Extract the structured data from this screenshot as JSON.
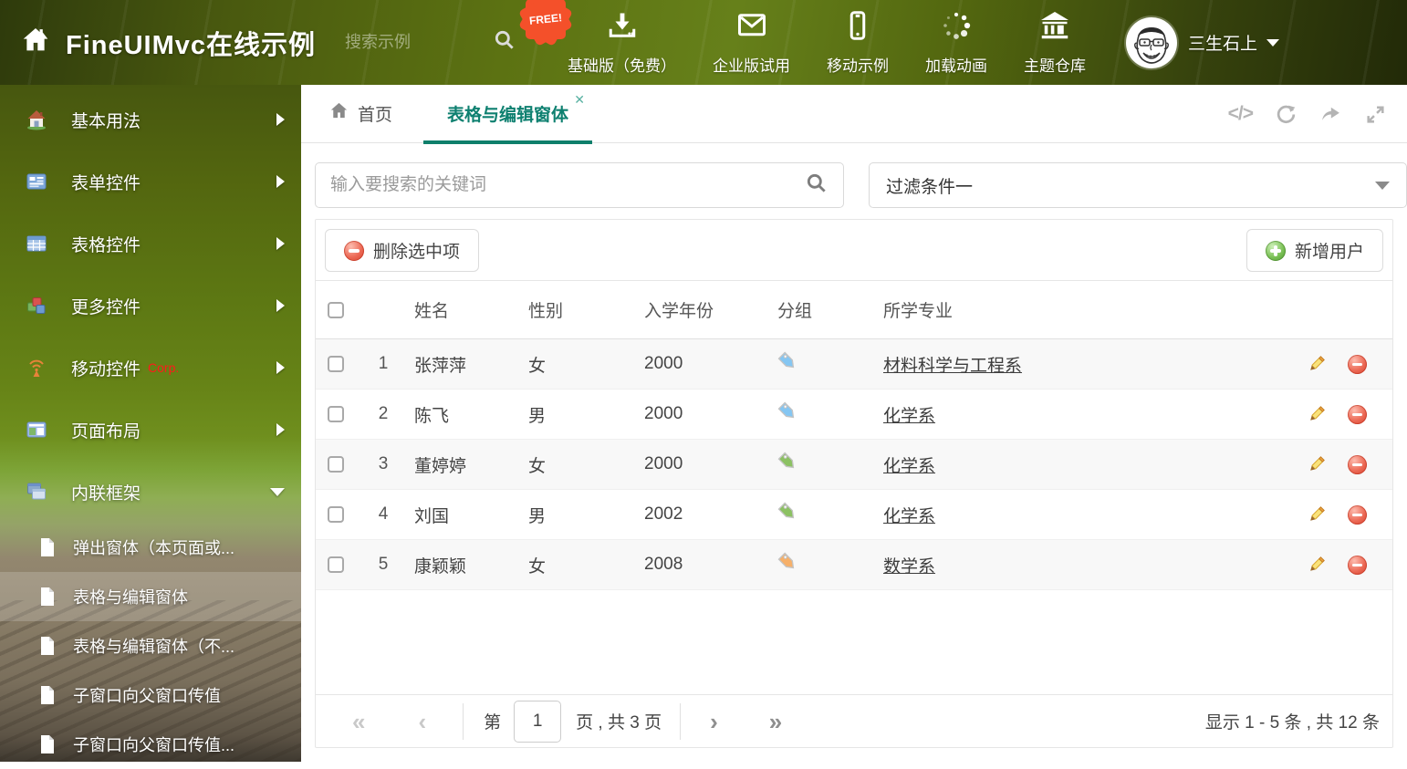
{
  "colors": {
    "accent_teal": "#0e8070",
    "badge_red": "#f4502a",
    "corp_red": "#ff1a1a",
    "tag_blue": "#85c6f2",
    "tag_green": "#8cc163",
    "tag_orange": "#f6b06a"
  },
  "header": {
    "title": "FineUIMvc在线示例",
    "search_placeholder": "搜索示例",
    "free_badge": "FREE!",
    "nav": [
      {
        "label": "基础版（免费）",
        "icon": "download-icon"
      },
      {
        "label": "企业版试用",
        "icon": "envelope-icon"
      },
      {
        "label": "移动示例",
        "icon": "mobile-icon"
      },
      {
        "label": "加载动画",
        "icon": "spinner-icon"
      },
      {
        "label": "主题仓库",
        "icon": "bank-icon"
      }
    ],
    "username": "三生石上"
  },
  "sidebar": {
    "items": [
      {
        "label": "基本用法"
      },
      {
        "label": "表单控件"
      },
      {
        "label": "表格控件"
      },
      {
        "label": "更多控件"
      },
      {
        "label": "移动控件",
        "badge": "Corp."
      },
      {
        "label": "页面布局"
      },
      {
        "label": "内联框架"
      }
    ],
    "subitems": [
      {
        "label": "弹出窗体（本页面或..."
      },
      {
        "label": "表格与编辑窗体"
      },
      {
        "label": "表格与编辑窗体（不..."
      },
      {
        "label": "子窗口向父窗口传值"
      },
      {
        "label": "子窗口向父窗口传值..."
      }
    ]
  },
  "tabs": {
    "home_label": "首页",
    "active_label": "表格与编辑窗体",
    "close_glyph": "✕"
  },
  "filters": {
    "search_placeholder": "输入要搜索的关键词",
    "selected": "过滤条件一"
  },
  "toolbar": {
    "delete_label": "删除选中项",
    "add_label": "新增用户"
  },
  "table": {
    "columns": [
      "姓名",
      "性别",
      "入学年份",
      "分组",
      "所学专业"
    ],
    "rows": [
      {
        "index": "1",
        "name": "张萍萍",
        "gender": "女",
        "year": "2000",
        "tag_color": "#85c6f2",
        "major": "材料科学与工程系"
      },
      {
        "index": "2",
        "name": "陈飞",
        "gender": "男",
        "year": "2000",
        "tag_color": "#85c6f2",
        "major": "化学系"
      },
      {
        "index": "3",
        "name": "董婷婷",
        "gender": "女",
        "year": "2000",
        "tag_color": "#8cc163",
        "major": "化学系"
      },
      {
        "index": "4",
        "name": "刘国",
        "gender": "男",
        "year": "2002",
        "tag_color": "#8cc163",
        "major": "化学系"
      },
      {
        "index": "5",
        "name": "康颖颖",
        "gender": "女",
        "year": "2008",
        "tag_color": "#f6b06a",
        "major": "数学系"
      }
    ]
  },
  "pagination": {
    "label_pre": "第",
    "current_page": "1",
    "label_post": "页 , 共 3 页",
    "summary": "显示 1 - 5 条 , 共 12 条"
  }
}
